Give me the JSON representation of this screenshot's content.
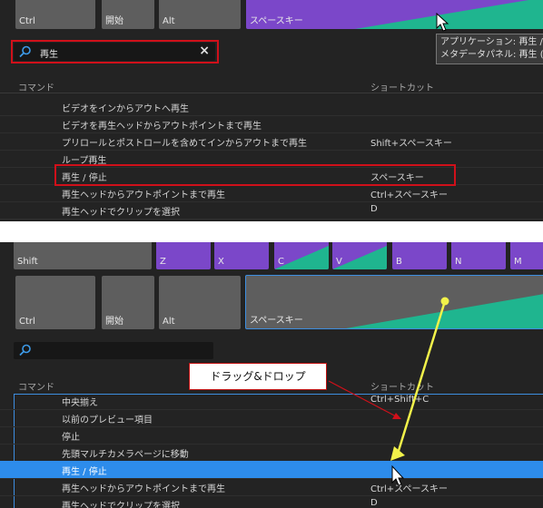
{
  "top": {
    "keys": {
      "ctrl": "Ctrl",
      "kaishi": "開始",
      "alt": "Alt",
      "space": "スペースキー"
    },
    "search": {
      "value": "再生"
    },
    "tooltip": {
      "line1": "アプリケーション: 再生 /",
      "line2": "メタデータパネル: 再生 ("
    },
    "headers": {
      "command": "コマンド",
      "shortcut": "ショートカット"
    },
    "rows": [
      {
        "command": "ビデオをインからアウトへ再生",
        "shortcut": ""
      },
      {
        "command": "ビデオを再生ヘッドからアウトポイントまで再生",
        "shortcut": ""
      },
      {
        "command": "プリロールとポストロールを含めてインからアウトまで再生",
        "shortcut": "Shift+スペースキー"
      },
      {
        "command": "ループ再生",
        "shortcut": ""
      },
      {
        "command": "再生 / 停止",
        "shortcut": "スペースキー"
      },
      {
        "command": "再生ヘッドからアウトポイントまで再生",
        "shortcut": "Ctrl+スペースキー"
      },
      {
        "command": "再生ヘッドでクリップを選択",
        "shortcut": "D"
      }
    ]
  },
  "bottom": {
    "keys": {
      "shift": "Shift",
      "z": "Z",
      "x": "X",
      "c": "C",
      "v": "V",
      "b": "B",
      "n": "N",
      "m": "M",
      "ctrl": "Ctrl",
      "kaishi": "開始",
      "alt": "Alt",
      "space": "スペースキー"
    },
    "search": {
      "value": ""
    },
    "headers": {
      "command": "コマンド",
      "shortcut": "ショートカット"
    },
    "callout": "ドラッグ&ドロップ",
    "rows": [
      {
        "command": "中央揃え",
        "shortcut": "Ctrl+Shift+C"
      },
      {
        "command": "以前のプレビュー項目",
        "shortcut": ""
      },
      {
        "command": "停止",
        "shortcut": ""
      },
      {
        "command": "先頭マルチカメラページに移動",
        "shortcut": ""
      },
      {
        "command": "再生 / 停止",
        "shortcut": ""
      },
      {
        "command": "再生ヘッドからアウトポイントまで再生",
        "shortcut": "Ctrl+スペースキー"
      },
      {
        "command": "再生ヘッドでクリップを選択",
        "shortcut": "D"
      }
    ]
  },
  "colors": {
    "panel": "#232323",
    "purple": "#7b47c9",
    "green": "#1fb58f",
    "selected": "#2d8ceb",
    "annotation_red": "#d0101a",
    "arrow_yellow": "#f5f542"
  }
}
